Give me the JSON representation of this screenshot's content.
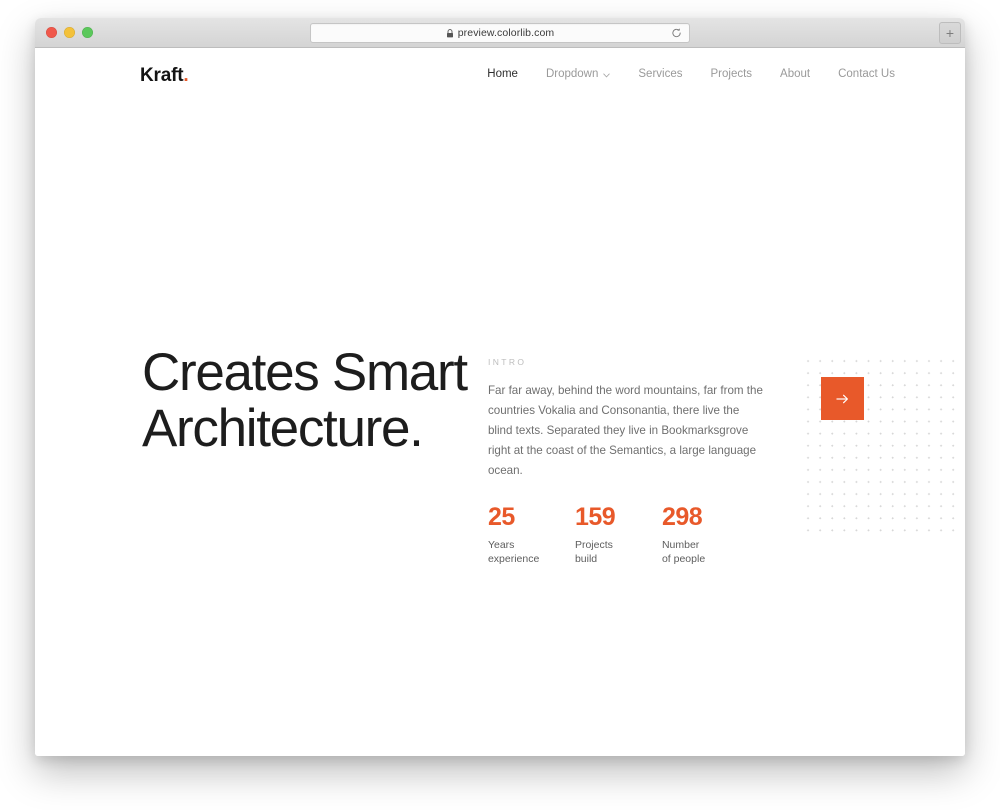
{
  "browser": {
    "traffic_lights": [
      "close",
      "minimize",
      "zoom"
    ],
    "url": "preview.colorlib.com",
    "lock_icon": "lock-icon",
    "reload_icon": "reload-icon",
    "newtab_label": "+"
  },
  "site": {
    "logo": {
      "text": "Kraft",
      "dot": "."
    },
    "nav": [
      {
        "label": "Home",
        "active": true,
        "has_dropdown": false
      },
      {
        "label": "Dropdown",
        "active": false,
        "has_dropdown": true
      },
      {
        "label": "Services",
        "active": false,
        "has_dropdown": false
      },
      {
        "label": "Projects",
        "active": false,
        "has_dropdown": false
      },
      {
        "label": "About",
        "active": false,
        "has_dropdown": false
      },
      {
        "label": "Contact Us",
        "active": false,
        "has_dropdown": false
      }
    ],
    "hero": {
      "title_line1": "Creates Smart",
      "title_line2": "Architecture.",
      "intro_label": "INTRO",
      "intro_text": "Far far away, behind the word mountains, far from the countries Vokalia and Consonantia, there live the blind texts. Separated they live in Bookmarksgrove right at the coast of the Semantics, a large language ocean.",
      "stats": [
        {
          "number": "25",
          "label_line1": "Years",
          "label_line2": "experience"
        },
        {
          "number": "159",
          "label_line1": "Projects",
          "label_line2": "build"
        },
        {
          "number": "298",
          "label_line1": "Number",
          "label_line2": "of people"
        }
      ],
      "cta_icon": "arrow-right-icon"
    }
  },
  "colors": {
    "accent": "#e8592a",
    "heading": "#1d1d1d",
    "body_text": "#6f6f6f",
    "nav_inactive": "#9a9a9a",
    "nav_active": "#2e2e2e",
    "dot_grid": "#d7d7d7",
    "page_bg": "#ffffff"
  }
}
